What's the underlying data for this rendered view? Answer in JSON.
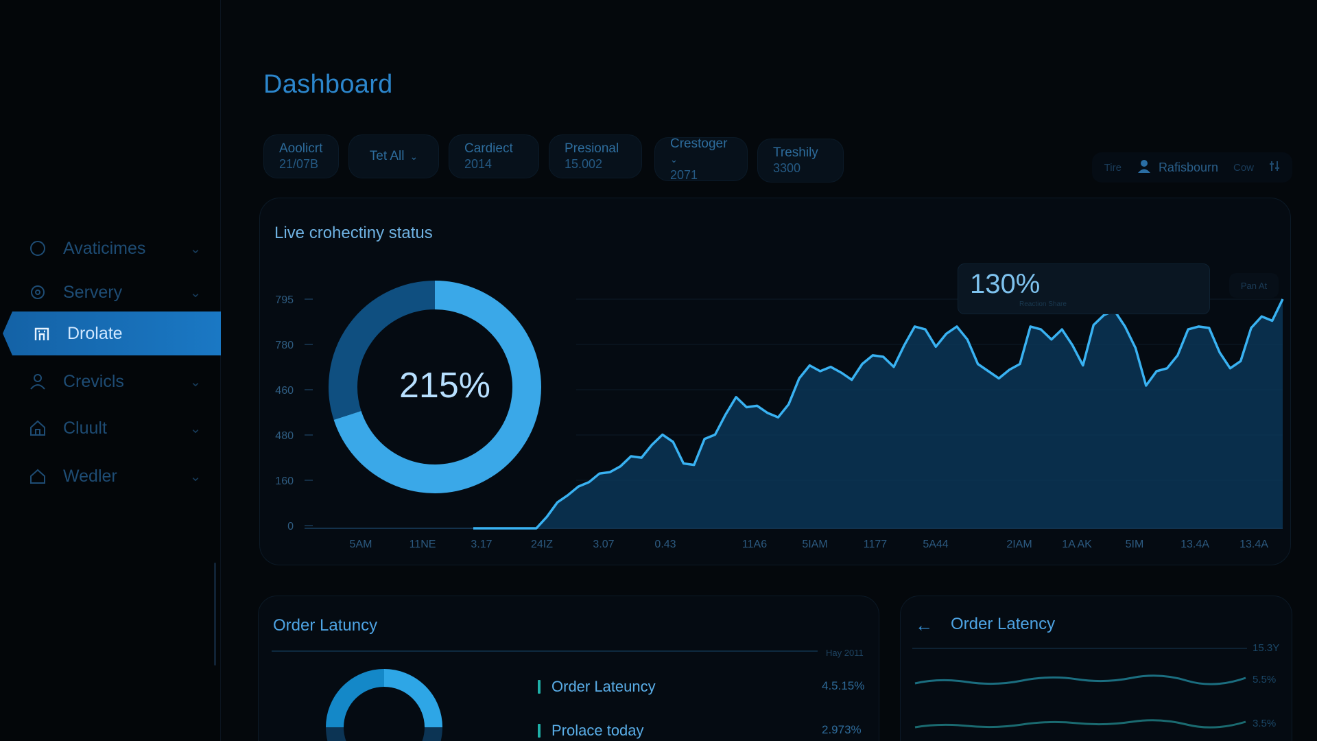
{
  "sidebar": {
    "items": [
      {
        "label": "Avaticimes",
        "icon": "circle-icon",
        "active": false
      },
      {
        "label": "Servery",
        "icon": "gear-icon",
        "active": false
      },
      {
        "label": "Drolate",
        "icon": "building-icon",
        "active": true
      },
      {
        "label": "Crevicls",
        "icon": "user-icon",
        "active": false
      },
      {
        "label": "Cluult",
        "icon": "home-icon",
        "active": false
      },
      {
        "label": "Wedler",
        "icon": "house-icon",
        "active": false
      }
    ]
  },
  "header": {
    "title": "Dashboard"
  },
  "filters": [
    {
      "line1": "Aoolicrt",
      "line2": "21/07B"
    },
    {
      "line1": "Tet All",
      "line2": "",
      "select": true
    },
    {
      "line1": "Cardiect",
      "line2": "2014"
    },
    {
      "line1": "Presional",
      "line2": "15.002"
    },
    {
      "line1": "Crestoger",
      "line2": "2071",
      "select": true
    },
    {
      "line1": "Treshily",
      "line2": "3300"
    }
  ],
  "topright": {
    "left_label": "Tire",
    "user_label": "Rafisbourn",
    "right_label": "Cow"
  },
  "main": {
    "title": "Live crohectiny status",
    "donut_value": "215%",
    "kpi_value": "130%",
    "kpi_sub": "Reaction Share",
    "kpi_button": "Pan At"
  },
  "chart_data": [
    {
      "type": "pie",
      "values": [
        70,
        30
      ],
      "center_label": "215%",
      "colors": [
        "#3aa8e8",
        "#0f4f80"
      ]
    },
    {
      "type": "area",
      "y_ticks": [
        "795",
        "780",
        "460",
        "480",
        "160",
        "0"
      ],
      "x_ticks": [
        "5AM",
        "11NE",
        "3.17",
        "24IZ",
        "3.07",
        "0.43",
        "11A6",
        "5IAM",
        "1177",
        "5A44",
        "2IAM",
        "1A AK",
        "5IM",
        "13.4A",
        "13.4A"
      ],
      "ylim": [
        0,
        795
      ],
      "values": [
        0,
        0,
        0,
        0,
        0,
        0,
        0,
        40,
        90,
        115,
        145,
        160,
        190,
        195,
        215,
        250,
        245,
        290,
        325,
        300,
        225,
        220,
        310,
        325,
        395,
        455,
        420,
        425,
        400,
        385,
        430,
        520,
        565,
        545,
        560,
        540,
        515,
        570,
        600,
        595,
        560,
        635,
        700,
        690,
        630,
        675,
        700,
        655,
        570,
        545,
        520,
        550,
        570,
        700,
        690,
        655,
        690,
        635,
        565,
        705,
        740,
        755,
        700,
        625,
        495,
        545,
        555,
        600,
        690,
        700,
        695,
        610,
        555,
        580,
        695,
        735,
        720,
        795
      ],
      "fill": "#0a3556",
      "stroke": "#39b2f2"
    }
  ],
  "bottom_left": {
    "title": "Order Latuncy",
    "subtitle": "Hay 2011",
    "metrics": [
      {
        "label": "Order Lateuncy",
        "value": "4.5.15%"
      },
      {
        "label": "Prolace today",
        "value": "2.973%"
      }
    ]
  },
  "bottom_right": {
    "title": "Order Latency",
    "values": [
      "15.3Y",
      "5.5%",
      "3.5%"
    ]
  }
}
